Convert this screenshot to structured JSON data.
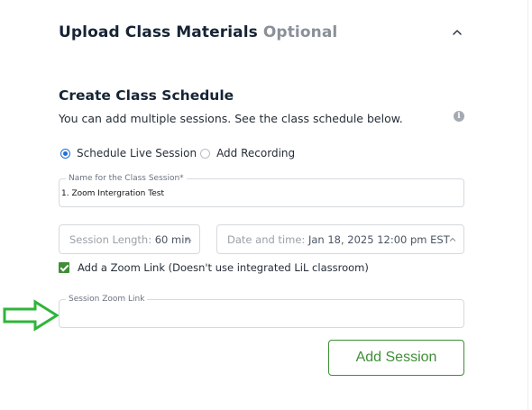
{
  "upload_section": {
    "title": "Upload Class Materials",
    "optional_tag": "Optional"
  },
  "schedule": {
    "title": "Create Class Schedule",
    "description": "You can add multiple sessions. See the class schedule below.",
    "session_type": {
      "options": [
        {
          "label": "Schedule Live Session",
          "selected": true
        },
        {
          "label": "Add Recording",
          "selected": false
        }
      ]
    },
    "session_name": {
      "label": "Name for the Class Session*",
      "value": "1. Zoom Intergration Test"
    },
    "session_length": {
      "label": "Session Length:",
      "value": "60 min"
    },
    "date_time": {
      "label": "Date and time:",
      "value": "Jan 18, 2025 12:00 pm EST"
    },
    "zoom_link_checkbox": {
      "label": "Add a Zoom Link (Doesn't use integrated LiL classroom)",
      "checked": true
    },
    "zoom_link_field": {
      "label": "Session Zoom Link",
      "value": ""
    },
    "add_session_label": "Add Session"
  },
  "colors": {
    "accent_green": "#3e8e36",
    "radio_blue": "#1e6fd9",
    "annotation_arrow": "#2fb53a",
    "heading": "#162435",
    "muted": "#8a9098"
  },
  "icons": {
    "collapse": "chevron-up-icon",
    "info": "info-icon",
    "select_caret": "chevron-up-icon",
    "annotation": "arrow-right-icon"
  }
}
